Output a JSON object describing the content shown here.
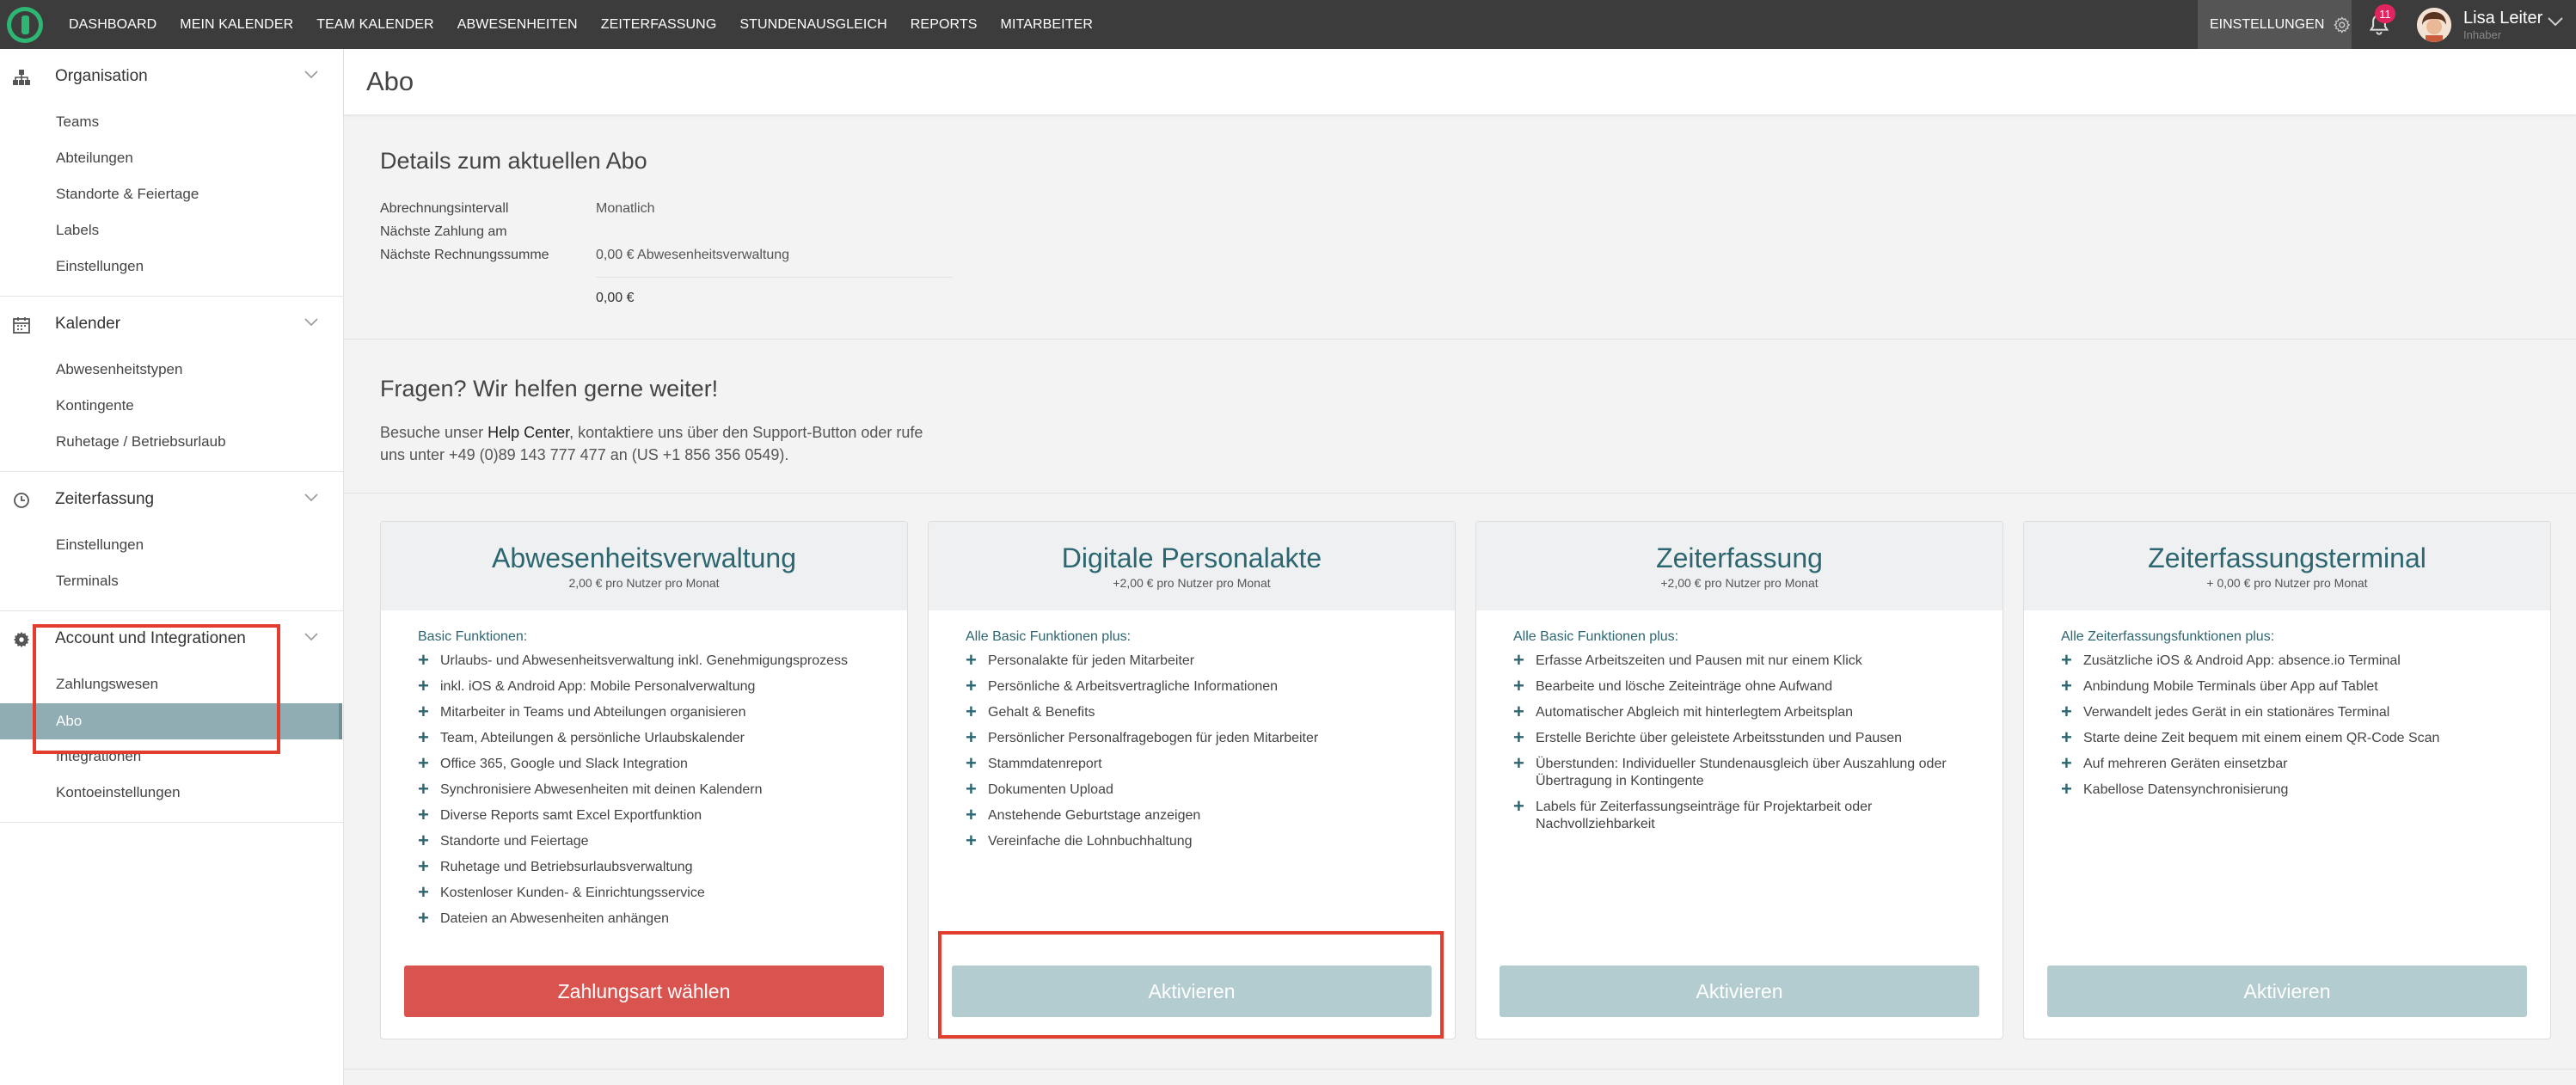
{
  "topbar": {
    "nav": [
      "DASHBOARD",
      "MEIN KALENDER",
      "TEAM KALENDER",
      "ABWESENHEITEN",
      "ZEITERFASSUNG",
      "STUNDENAUSGLEICH",
      "REPORTS",
      "MITARBEITER"
    ],
    "settings_label": "EINSTELLUNGEN",
    "notification_count": "11",
    "user_name": "Lisa Leiter",
    "user_role": "Inhaber"
  },
  "sidebar": {
    "organisation": {
      "title": "Organisation",
      "items": [
        "Teams",
        "Abteilungen",
        "Standorte & Feiertage",
        "Labels",
        "Einstellungen"
      ]
    },
    "kalender": {
      "title": "Kalender",
      "items": [
        "Abwesenheitstypen",
        "Kontingente",
        "Ruhetage / Betriebsurlaub"
      ]
    },
    "zeiterfassung": {
      "title": "Zeiterfassung",
      "items": [
        "Einstellungen",
        "Terminals"
      ]
    },
    "account": {
      "title": "Account und Integrationen",
      "items": [
        "Zahlungswesen",
        "Abo",
        "Integrationen",
        "Kontoeinstellungen"
      ]
    }
  },
  "page": {
    "title": "Abo",
    "details_title": "Details zum aktuellen Abo",
    "details": [
      {
        "label": "Abrechnungsintervall",
        "value": "Monatlich"
      },
      {
        "label": "Nächste Zahlung am",
        "value": ""
      },
      {
        "label": "Nächste Rechnungssumme",
        "value": "0,00 € Abwesenheitsverwaltung"
      }
    ],
    "total": "0,00 €",
    "help_title": "Fragen? Wir helfen gerne weiter!",
    "help_pre": "Besuche unser ",
    "help_link": "Help Center",
    "help_post": ", kontaktiere uns über den Support-Button oder rufe uns unter +49 (0)89 143 777 477 an (US +1 856 356 0549)."
  },
  "cards": [
    {
      "title": "Abwesenheitsverwaltung",
      "price": "2,00 € pro Nutzer pro Monat",
      "features_title": "Basic Funktionen:",
      "features": [
        "Urlaubs- und Abwesenheitsverwaltung inkl. Genehmigungsprozess",
        "inkl. iOS & Android App: Mobile Personalverwaltung",
        "Mitarbeiter in Teams und Abteilungen organisieren",
        "Team, Abteilungen & persönliche Urlaubskalender",
        "Office 365, Google und Slack Integration",
        "Synchronisiere Abwesenheiten mit deinen Kalendern",
        "Diverse Reports samt Excel Exportfunktion",
        "Standorte und Feiertage",
        "Ruhetage und Betriebsurlaubsverwaltung",
        "Kostenloser Kunden- & Einrichtungsservice",
        "Dateien an Abwesenheiten anhängen"
      ],
      "button": "Zahlungsart wählen",
      "button_style": "red"
    },
    {
      "title": "Digitale Personalakte",
      "price": "+2,00 € pro Nutzer pro Monat",
      "features_title": "Alle Basic Funktionen plus:",
      "features": [
        "Personalakte für jeden Mitarbeiter",
        "Persönliche & Arbeitsvertragliche Informationen",
        "Gehalt & Benefits",
        "Persönlicher Personalfragebogen für jeden Mitarbeiter",
        "Stammdatenreport",
        "Dokumenten Upload",
        "Anstehende Geburtstage anzeigen",
        "Vereinfache die Lohnbuchhaltung"
      ],
      "button": "Aktivieren",
      "button_style": "gray"
    },
    {
      "title": "Zeiterfassung",
      "price": "+2,00 € pro Nutzer pro Monat",
      "features_title": "Alle Basic Funktionen plus:",
      "features": [
        "Erfasse Arbeitszeiten und Pausen mit nur einem Klick",
        "Bearbeite und lösche Zeiteinträge ohne Aufwand",
        "Automatischer Abgleich mit hinterlegtem Arbeitsplan",
        "Erstelle Berichte über geleistete Arbeitsstunden und Pausen",
        "Überstunden: Individueller Stundenausgleich über Auszahlung oder Übertragung in Kontingente",
        "Labels für Zeiterfassungseinträge für Projektarbeit oder Nachvollziehbarkeit"
      ],
      "button": "Aktivieren",
      "button_style": "gray"
    },
    {
      "title": "Zeiterfassungsterminal",
      "price": "+ 0,00 € pro Nutzer pro Monat",
      "features_title": "Alle Zeiterfassungsfunktionen plus:",
      "features": [
        "Zusätzliche iOS & Android App: absence.io Terminal",
        "Anbindung Mobile Terminals über App auf Tablet",
        "Verwandelt jedes Gerät in ein stationäres Terminal",
        "Starte deine Zeit bequem mit einem einem QR-Code Scan",
        "Auf mehreren Geräten einsetzbar",
        "Kabellose Datensynchronisierung"
      ],
      "button": "Aktivieren",
      "button_style": "gray"
    }
  ],
  "colors": {
    "accent": "#2c6670",
    "primary_button": "#d9534f",
    "disabled_button": "#b3cccf",
    "active_nav": "#90adb3",
    "highlight": "#e23d2d",
    "logo": "#2eb772"
  }
}
